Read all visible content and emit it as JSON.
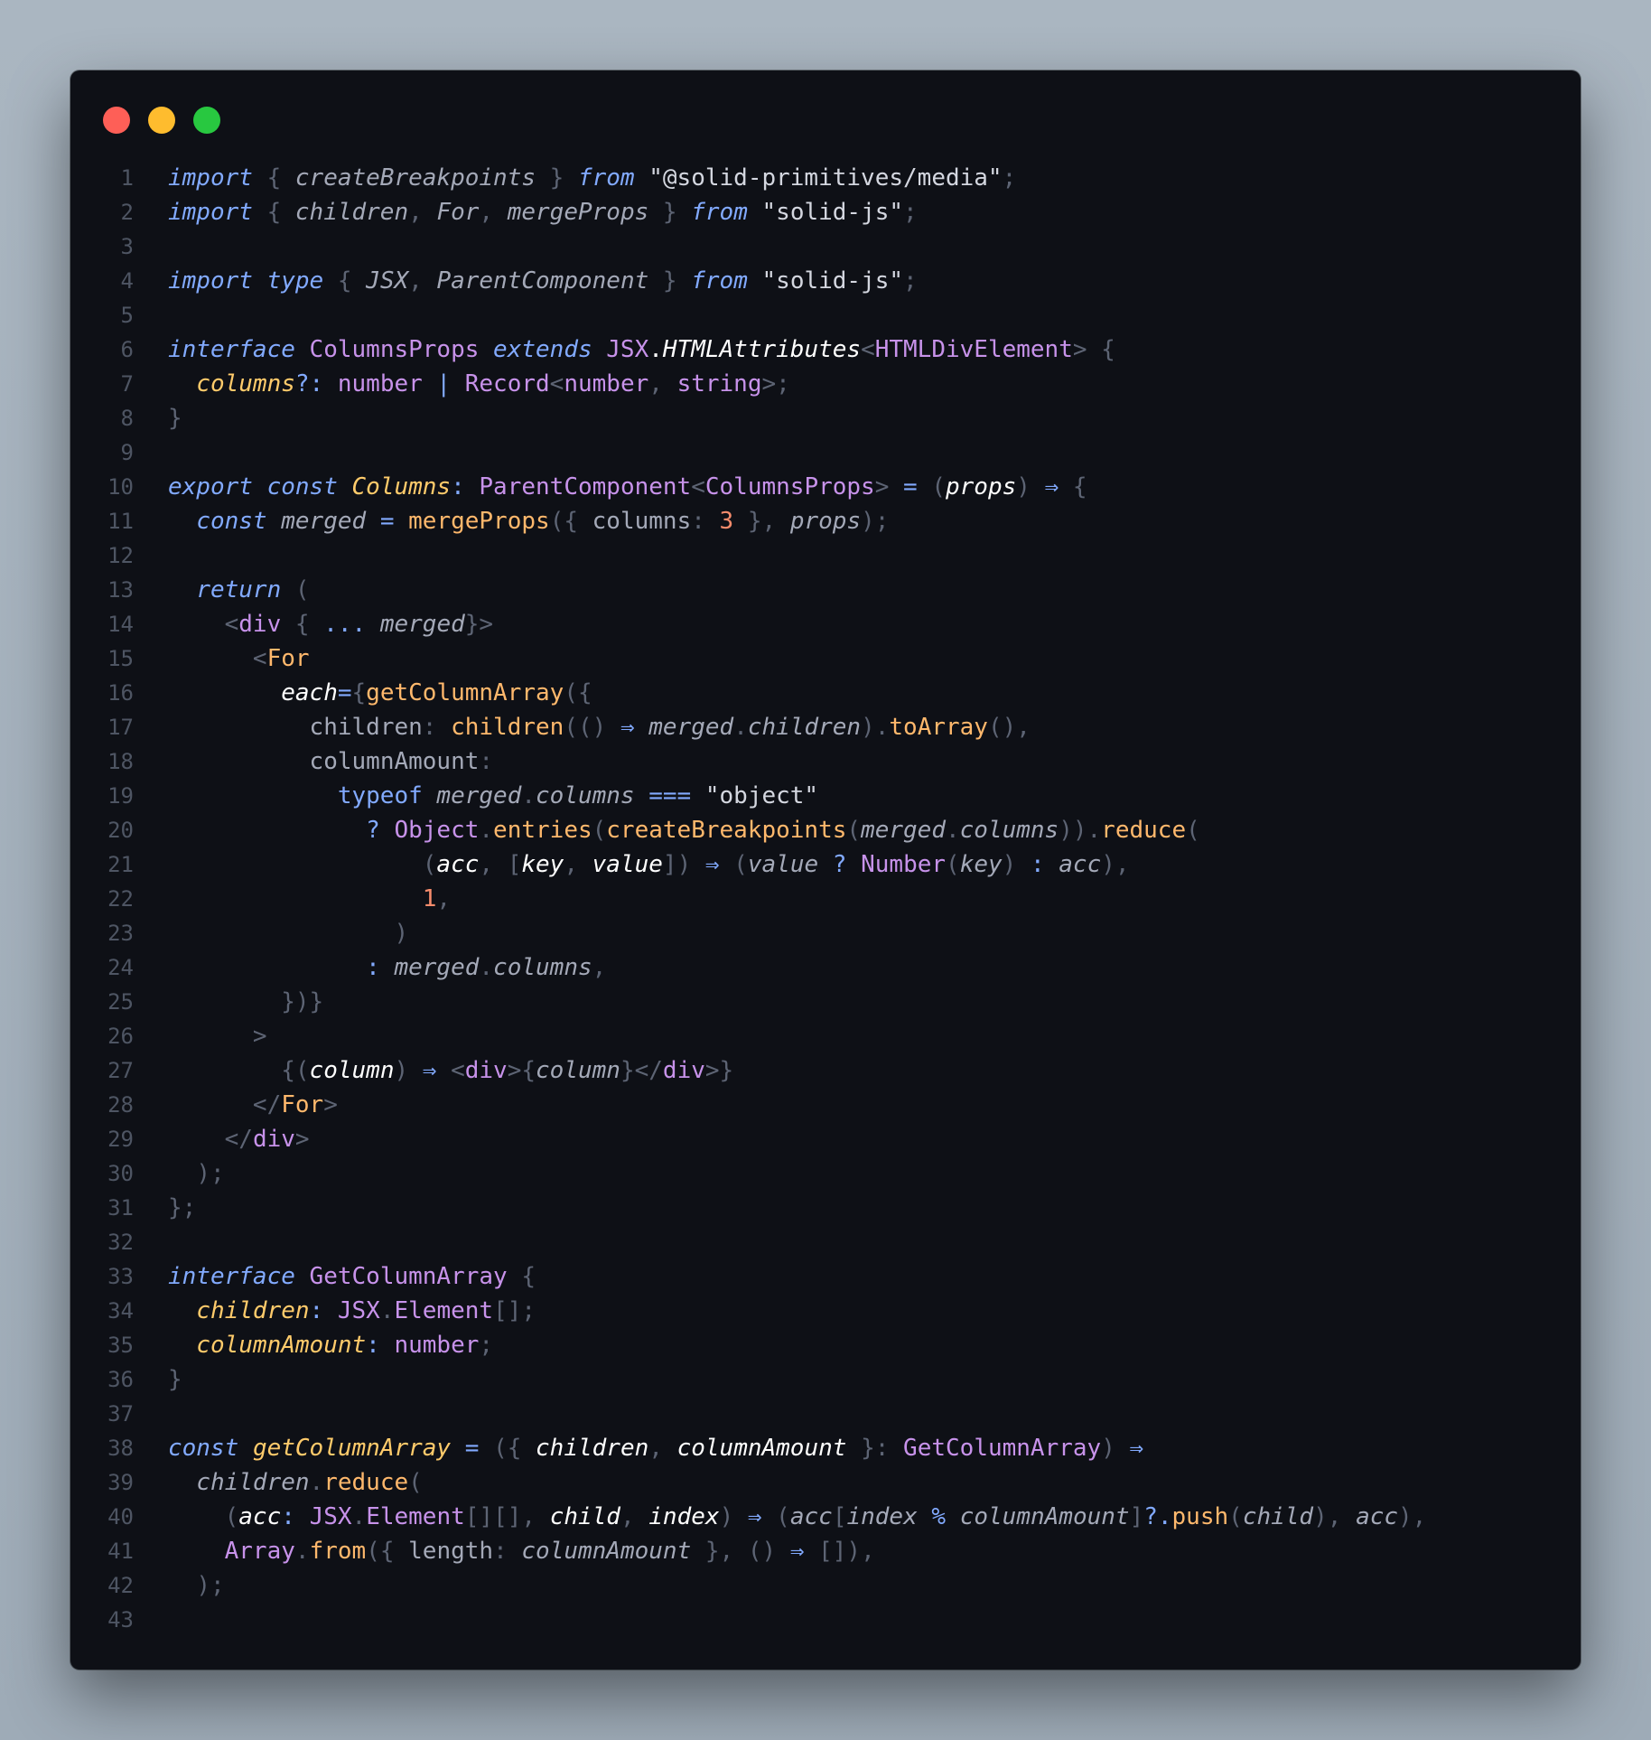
{
  "window": {
    "buttons": {
      "close": "close",
      "minimize": "minimize",
      "zoom": "zoom"
    }
  },
  "code": {
    "lines": [
      [
        [
          "kw",
          "import"
        ],
        [
          "pu",
          " { "
        ],
        [
          "va",
          "createBreakpoints"
        ],
        [
          "pu",
          " } "
        ],
        [
          "kw",
          "from"
        ],
        [
          "st",
          " \"@solid-primitives/media\""
        ],
        [
          "pu",
          ";"
        ]
      ],
      [
        [
          "kw",
          "import"
        ],
        [
          "pu",
          " { "
        ],
        [
          "va",
          "children"
        ],
        [
          "pu",
          ", "
        ],
        [
          "va",
          "For"
        ],
        [
          "pu",
          ", "
        ],
        [
          "va",
          "mergeProps"
        ],
        [
          "pu",
          " } "
        ],
        [
          "kw",
          "from"
        ],
        [
          "st",
          " \"solid-js\""
        ],
        [
          "pu",
          ";"
        ]
      ],
      [],
      [
        [
          "kw",
          "import"
        ],
        [
          "pl",
          " "
        ],
        [
          "kw",
          "type"
        ],
        [
          "pu",
          " { "
        ],
        [
          "va",
          "JSX"
        ],
        [
          "pu",
          ", "
        ],
        [
          "va",
          "ParentComponent"
        ],
        [
          "pu",
          " } "
        ],
        [
          "kw",
          "from"
        ],
        [
          "st",
          " \"solid-js\""
        ],
        [
          "pu",
          ";"
        ]
      ],
      [],
      [
        [
          "kw",
          "interface"
        ],
        [
          "pl",
          " "
        ],
        [
          "ty",
          "ColumnsProps"
        ],
        [
          "pl",
          " "
        ],
        [
          "kw",
          "extends"
        ],
        [
          "pl",
          " "
        ],
        [
          "ty",
          "JSX"
        ],
        [
          "pl",
          "."
        ],
        [
          "vw",
          "HTMLAttributes"
        ],
        [
          "pu",
          "<"
        ],
        [
          "ty",
          "HTMLDivElement"
        ],
        [
          "pu",
          "> {"
        ]
      ],
      [
        [
          "pl",
          "  "
        ],
        [
          "pa",
          "columns"
        ],
        [
          "op",
          "?:"
        ],
        [
          "pl",
          " "
        ],
        [
          "ty",
          "number"
        ],
        [
          "op",
          " | "
        ],
        [
          "ty",
          "Record"
        ],
        [
          "pu",
          "<"
        ],
        [
          "ty",
          "number"
        ],
        [
          "pu",
          ", "
        ],
        [
          "ty",
          "string"
        ],
        [
          "pu",
          ">;"
        ]
      ],
      [
        [
          "pu",
          "}"
        ]
      ],
      [],
      [
        [
          "kw",
          "export"
        ],
        [
          "pl",
          " "
        ],
        [
          "kw",
          "const"
        ],
        [
          "pl",
          " "
        ],
        [
          "pa",
          "Columns"
        ],
        [
          "op",
          ": "
        ],
        [
          "ty",
          "ParentComponent"
        ],
        [
          "pu",
          "<"
        ],
        [
          "ty",
          "ColumnsProps"
        ],
        [
          "pu",
          "> "
        ],
        [
          "op",
          "="
        ],
        [
          "pu",
          " ("
        ],
        [
          "vw",
          "props"
        ],
        [
          "pu",
          ") "
        ],
        [
          "op",
          "⇒"
        ],
        [
          "pu",
          " {"
        ]
      ],
      [
        [
          "pl",
          "  "
        ],
        [
          "kw",
          "const"
        ],
        [
          "pl",
          " "
        ],
        [
          "va",
          "merged"
        ],
        [
          "op",
          " = "
        ],
        [
          "fn",
          "mergeProps"
        ],
        [
          "pu",
          "({ "
        ],
        [
          "pr",
          "columns"
        ],
        [
          "pu",
          ": "
        ],
        [
          "nu",
          "3"
        ],
        [
          "pu",
          " }, "
        ],
        [
          "va",
          "props"
        ],
        [
          "pu",
          ");"
        ]
      ],
      [],
      [
        [
          "pl",
          "  "
        ],
        [
          "kw",
          "return"
        ],
        [
          "pu",
          " ("
        ]
      ],
      [
        [
          "pl",
          "    "
        ],
        [
          "pu",
          "<"
        ],
        [
          "ta",
          "div"
        ],
        [
          "pu",
          " { "
        ],
        [
          "op",
          "..."
        ],
        [
          "pl",
          " "
        ],
        [
          "va",
          "merged"
        ],
        [
          "pu",
          "}>"
        ]
      ],
      [
        [
          "pl",
          "      "
        ],
        [
          "pu",
          "<"
        ],
        [
          "fn",
          "For"
        ]
      ],
      [
        [
          "pl",
          "        "
        ],
        [
          "vw",
          "each"
        ],
        [
          "op",
          "="
        ],
        [
          "pu",
          "{"
        ],
        [
          "fn",
          "getColumnArray"
        ],
        [
          "pu",
          "({"
        ]
      ],
      [
        [
          "pl",
          "          "
        ],
        [
          "pr",
          "children"
        ],
        [
          "pu",
          ": "
        ],
        [
          "fn",
          "children"
        ],
        [
          "pu",
          "(() "
        ],
        [
          "op",
          "⇒"
        ],
        [
          "pl",
          " "
        ],
        [
          "va",
          "merged"
        ],
        [
          "pu",
          "."
        ],
        [
          "va",
          "children"
        ],
        [
          "pu",
          ")."
        ],
        [
          "fn",
          "toArray"
        ],
        [
          "pu",
          "(),"
        ]
      ],
      [
        [
          "pl",
          "          "
        ],
        [
          "pr",
          "columnAmount"
        ],
        [
          "pu",
          ":"
        ]
      ],
      [
        [
          "pl",
          "            "
        ],
        [
          "ob",
          "typeof"
        ],
        [
          "pl",
          " "
        ],
        [
          "va",
          "merged"
        ],
        [
          "pu",
          "."
        ],
        [
          "va",
          "columns"
        ],
        [
          "op",
          " === "
        ],
        [
          "st",
          "\"object\""
        ]
      ],
      [
        [
          "pl",
          "              "
        ],
        [
          "op",
          "? "
        ],
        [
          "ty",
          "Object"
        ],
        [
          "pu",
          "."
        ],
        [
          "fn",
          "entries"
        ],
        [
          "pu",
          "("
        ],
        [
          "fn",
          "createBreakpoints"
        ],
        [
          "pu",
          "("
        ],
        [
          "va",
          "merged"
        ],
        [
          "pu",
          "."
        ],
        [
          "va",
          "columns"
        ],
        [
          "pu",
          "))."
        ],
        [
          "fn",
          "reduce"
        ],
        [
          "pu",
          "("
        ]
      ],
      [
        [
          "pl",
          "                  "
        ],
        [
          "pu",
          "("
        ],
        [
          "vw",
          "acc"
        ],
        [
          "pu",
          ", ["
        ],
        [
          "vw",
          "key"
        ],
        [
          "pu",
          ", "
        ],
        [
          "vw",
          "value"
        ],
        [
          "pu",
          "]) "
        ],
        [
          "op",
          "⇒"
        ],
        [
          "pu",
          " ("
        ],
        [
          "va",
          "value"
        ],
        [
          "op",
          " ? "
        ],
        [
          "ty",
          "Number"
        ],
        [
          "pu",
          "("
        ],
        [
          "va",
          "key"
        ],
        [
          "pu",
          ") "
        ],
        [
          "op",
          ": "
        ],
        [
          "va",
          "acc"
        ],
        [
          "pu",
          "),"
        ]
      ],
      [
        [
          "pl",
          "                  "
        ],
        [
          "nu",
          "1"
        ],
        [
          "pu",
          ","
        ]
      ],
      [
        [
          "pl",
          "                "
        ],
        [
          "pu",
          ")"
        ]
      ],
      [
        [
          "pl",
          "              "
        ],
        [
          "op",
          ": "
        ],
        [
          "va",
          "merged"
        ],
        [
          "pu",
          "."
        ],
        [
          "va",
          "columns"
        ],
        [
          "pu",
          ","
        ]
      ],
      [
        [
          "pl",
          "        "
        ],
        [
          "pu",
          "})}"
        ]
      ],
      [
        [
          "pl",
          "      "
        ],
        [
          "pu",
          ">"
        ]
      ],
      [
        [
          "pl",
          "        "
        ],
        [
          "pu",
          "{("
        ],
        [
          "vw",
          "column"
        ],
        [
          "pu",
          ") "
        ],
        [
          "op",
          "⇒"
        ],
        [
          "pu",
          " <"
        ],
        [
          "ta",
          "div"
        ],
        [
          "pu",
          ">{"
        ],
        [
          "va",
          "column"
        ],
        [
          "pu",
          "}</"
        ],
        [
          "ta",
          "div"
        ],
        [
          "pu",
          ">}"
        ]
      ],
      [
        [
          "pl",
          "      "
        ],
        [
          "pu",
          "</"
        ],
        [
          "fn",
          "For"
        ],
        [
          "pu",
          ">"
        ]
      ],
      [
        [
          "pl",
          "    "
        ],
        [
          "pu",
          "</"
        ],
        [
          "ta",
          "div"
        ],
        [
          "pu",
          ">"
        ]
      ],
      [
        [
          "pl",
          "  "
        ],
        [
          "pu",
          ");"
        ]
      ],
      [
        [
          "pu",
          "};"
        ]
      ],
      [],
      [
        [
          "kw",
          "interface"
        ],
        [
          "pl",
          " "
        ],
        [
          "ty",
          "GetColumnArray"
        ],
        [
          "pu",
          " {"
        ]
      ],
      [
        [
          "pl",
          "  "
        ],
        [
          "pa",
          "children"
        ],
        [
          "op",
          ": "
        ],
        [
          "ty",
          "JSX"
        ],
        [
          "pu",
          "."
        ],
        [
          "ty",
          "Element"
        ],
        [
          "pu",
          "[];"
        ]
      ],
      [
        [
          "pl",
          "  "
        ],
        [
          "pa",
          "columnAmount"
        ],
        [
          "op",
          ": "
        ],
        [
          "ty",
          "number"
        ],
        [
          "pu",
          ";"
        ]
      ],
      [
        [
          "pu",
          "}"
        ]
      ],
      [],
      [
        [
          "kw",
          "const"
        ],
        [
          "pl",
          " "
        ],
        [
          "pa",
          "getColumnArray"
        ],
        [
          "op",
          " = "
        ],
        [
          "pu",
          "({ "
        ],
        [
          "vw",
          "children"
        ],
        [
          "pu",
          ", "
        ],
        [
          "vw",
          "columnAmount"
        ],
        [
          "pu",
          " }: "
        ],
        [
          "ty",
          "GetColumnArray"
        ],
        [
          "pu",
          ") "
        ],
        [
          "op",
          "⇒"
        ]
      ],
      [
        [
          "pl",
          "  "
        ],
        [
          "va",
          "children"
        ],
        [
          "pu",
          "."
        ],
        [
          "fn",
          "reduce"
        ],
        [
          "pu",
          "("
        ]
      ],
      [
        [
          "pl",
          "    "
        ],
        [
          "pu",
          "("
        ],
        [
          "vw",
          "acc"
        ],
        [
          "op",
          ": "
        ],
        [
          "ty",
          "JSX"
        ],
        [
          "pu",
          "."
        ],
        [
          "ty",
          "Element"
        ],
        [
          "pu",
          "[][], "
        ],
        [
          "vw",
          "child"
        ],
        [
          "pu",
          ", "
        ],
        [
          "vw",
          "index"
        ],
        [
          "pu",
          ") "
        ],
        [
          "op",
          "⇒"
        ],
        [
          "pu",
          " ("
        ],
        [
          "va",
          "acc"
        ],
        [
          "pu",
          "["
        ],
        [
          "va",
          "index"
        ],
        [
          "op",
          " % "
        ],
        [
          "va",
          "columnAmount"
        ],
        [
          "pu",
          "]"
        ],
        [
          "op",
          "?."
        ],
        [
          "fn",
          "push"
        ],
        [
          "pu",
          "("
        ],
        [
          "va",
          "child"
        ],
        [
          "pu",
          "), "
        ],
        [
          "va",
          "acc"
        ],
        [
          "pu",
          "),"
        ]
      ],
      [
        [
          "pl",
          "    "
        ],
        [
          "ty",
          "Array"
        ],
        [
          "pu",
          "."
        ],
        [
          "fn",
          "from"
        ],
        [
          "pu",
          "({ "
        ],
        [
          "pr",
          "length"
        ],
        [
          "pu",
          ": "
        ],
        [
          "va",
          "columnAmount"
        ],
        [
          "pu",
          " }, () "
        ],
        [
          "op",
          "⇒"
        ],
        [
          "pu",
          " []),"
        ]
      ],
      [
        [
          "pl",
          "  "
        ],
        [
          "pu",
          ");"
        ]
      ],
      []
    ]
  }
}
